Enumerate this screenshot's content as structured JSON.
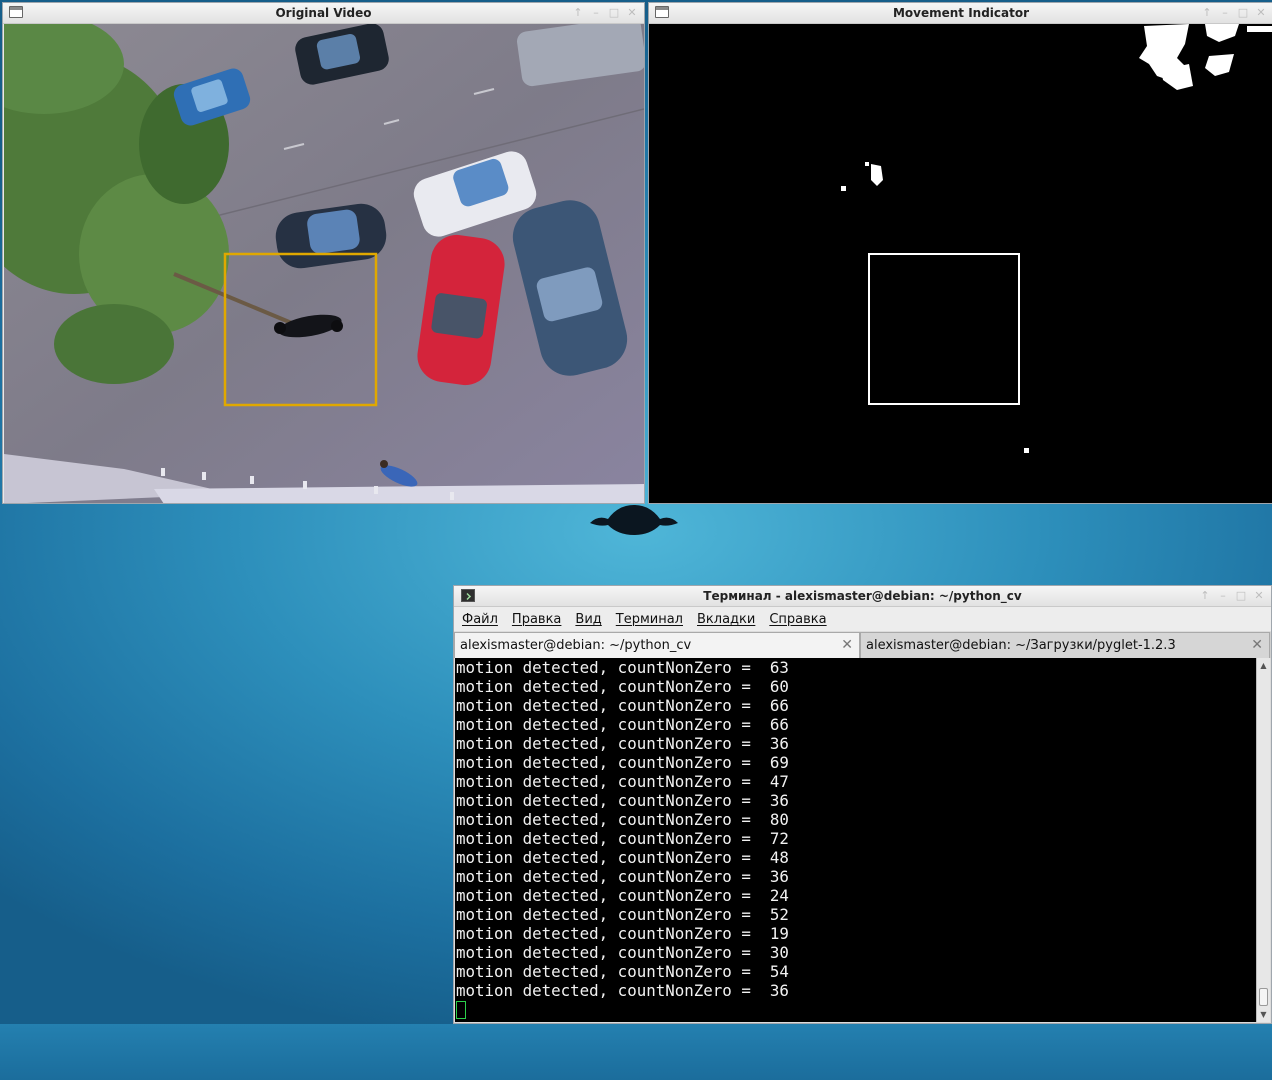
{
  "video_window": {
    "title": "Original Video",
    "controls": [
      "↑",
      "–",
      "□",
      "✕"
    ]
  },
  "motion_window": {
    "title": "Movement Indicator",
    "controls": [
      "↑",
      "–",
      "□",
      "✕"
    ]
  },
  "terminal": {
    "title": "Терминал - alexismaster@debian: ~/python_cv",
    "controls": [
      "↑",
      "–",
      "□",
      "✕"
    ],
    "menu": [
      "Файл",
      "Правка",
      "Вид",
      "Терминал",
      "Вкладки",
      "Справка"
    ],
    "tabs": [
      {
        "label": "alexismaster@debian: ~/python_cv",
        "close": "✕"
      },
      {
        "label": "alexismaster@debian: ~/Загрузки/pyglet-1.2.3",
        "close": "✕"
      }
    ],
    "line_prefix": "motion detected, countNonZero = ",
    "counts": [
      "63",
      "60",
      "66",
      "66",
      "36",
      "69",
      "47",
      "36",
      "80",
      "72",
      "48",
      "36",
      "24",
      "52",
      "19",
      "30",
      "54",
      "36"
    ],
    "scroll_up": "▲",
    "scroll_down": "▼"
  },
  "colors": {
    "desktop": "#2d8fbb",
    "bounding_box_video": "#e0a800",
    "bounding_box_motion": "#ffffff",
    "cursor": "#2bd14a"
  }
}
